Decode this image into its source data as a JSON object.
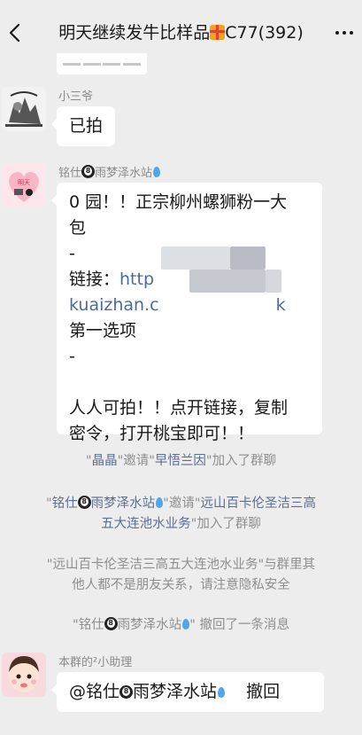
{
  "header": {
    "title_before_icon": "明天继续发牛比样品",
    "title_after_icon": "C77(392)",
    "title_icon": "gift-icon"
  },
  "messages": [
    {
      "sender": "小三爷",
      "text": "已拍"
    },
    {
      "sender_name": "铭仕",
      "sender_suffix": "雨梦泽水站",
      "lines": {
        "l1": "0 园！！正宗柳州螺狮粉一大",
        "l2": "包",
        "l3": "-",
        "l4_label": "链接：",
        "l4_link": "http",
        "l5_link": "kuaizhan.c",
        "l5_tail": "k",
        "l6": "第一选项",
        "l7": "-",
        "l8": "人人可拍！！点开链接，复制",
        "l9": "密令，打开桃宝即可！！"
      }
    },
    {
      "sender": "本群的²小助理",
      "mention": "@铭仕",
      "mention_suffix": "雨梦泽水站",
      "action": "撤回"
    }
  ],
  "system": {
    "s1_q1": "\"",
    "s1_name1": "晶晶",
    "s1_mid": "\"邀请\"",
    "s1_name2": "早悟兰因",
    "s1_end": "\"加入了群聊",
    "s2_q1": "\"",
    "s2_name1a": "铭仕",
    "s2_name1b": "雨梦泽水站",
    "s2_mid": "\"邀请\"",
    "s2_name2a": "远山百卡伦圣洁三高",
    "s2_name2b": "五大连池水业务",
    "s2_end": "\"加入了群聊",
    "s3_l1": "\"远山百卡伦圣洁三高五大连池水业务\"与群里其",
    "s3_l2": "他人都不是朋友关系，请注意隐私安全",
    "s4_q1": "\"",
    "s4_name_a": "铭仕",
    "s4_name_b": "雨梦泽水站",
    "s4_end": "\" 撤回了一条消息"
  },
  "colors": {
    "background": "#ededed",
    "bubble": "#ffffff",
    "link": "#4a6b9a",
    "system_name": "#5a6f92",
    "system_text": "#8e8e8e"
  }
}
